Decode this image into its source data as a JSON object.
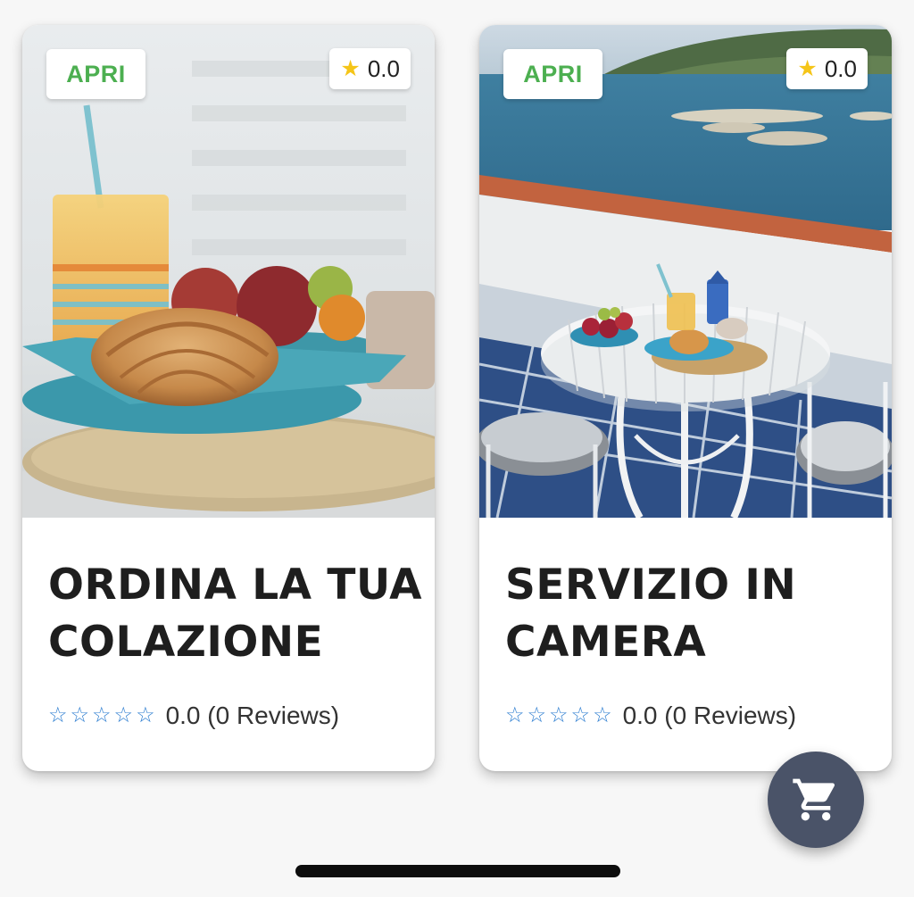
{
  "cards": [
    {
      "open_label": "APRI",
      "rating": "0.0",
      "title": "ORDINA LA TUA COLAZIONE",
      "review_stars": [
        "☆",
        "☆",
        "☆",
        "☆",
        "☆"
      ],
      "review_text": "0.0 (0 Reviews)",
      "image": "breakfast-croissant-juice-photo"
    },
    {
      "open_label": "APRI",
      "rating": "0.0",
      "title": "SERVIZIO IN CAMERA",
      "review_stars": [
        "☆",
        "☆",
        "☆",
        "☆",
        "☆"
      ],
      "review_text": "0.0 (0 Reviews)",
      "image": "terrace-sea-view-breakfast-photo"
    }
  ],
  "fab": {
    "icon": "shopping-cart-icon"
  },
  "colors": {
    "open_green": "#4caf50",
    "star_yellow": "#f5c518",
    "review_star_blue": "#2f7fd1",
    "fab_bg": "#4a5368"
  }
}
